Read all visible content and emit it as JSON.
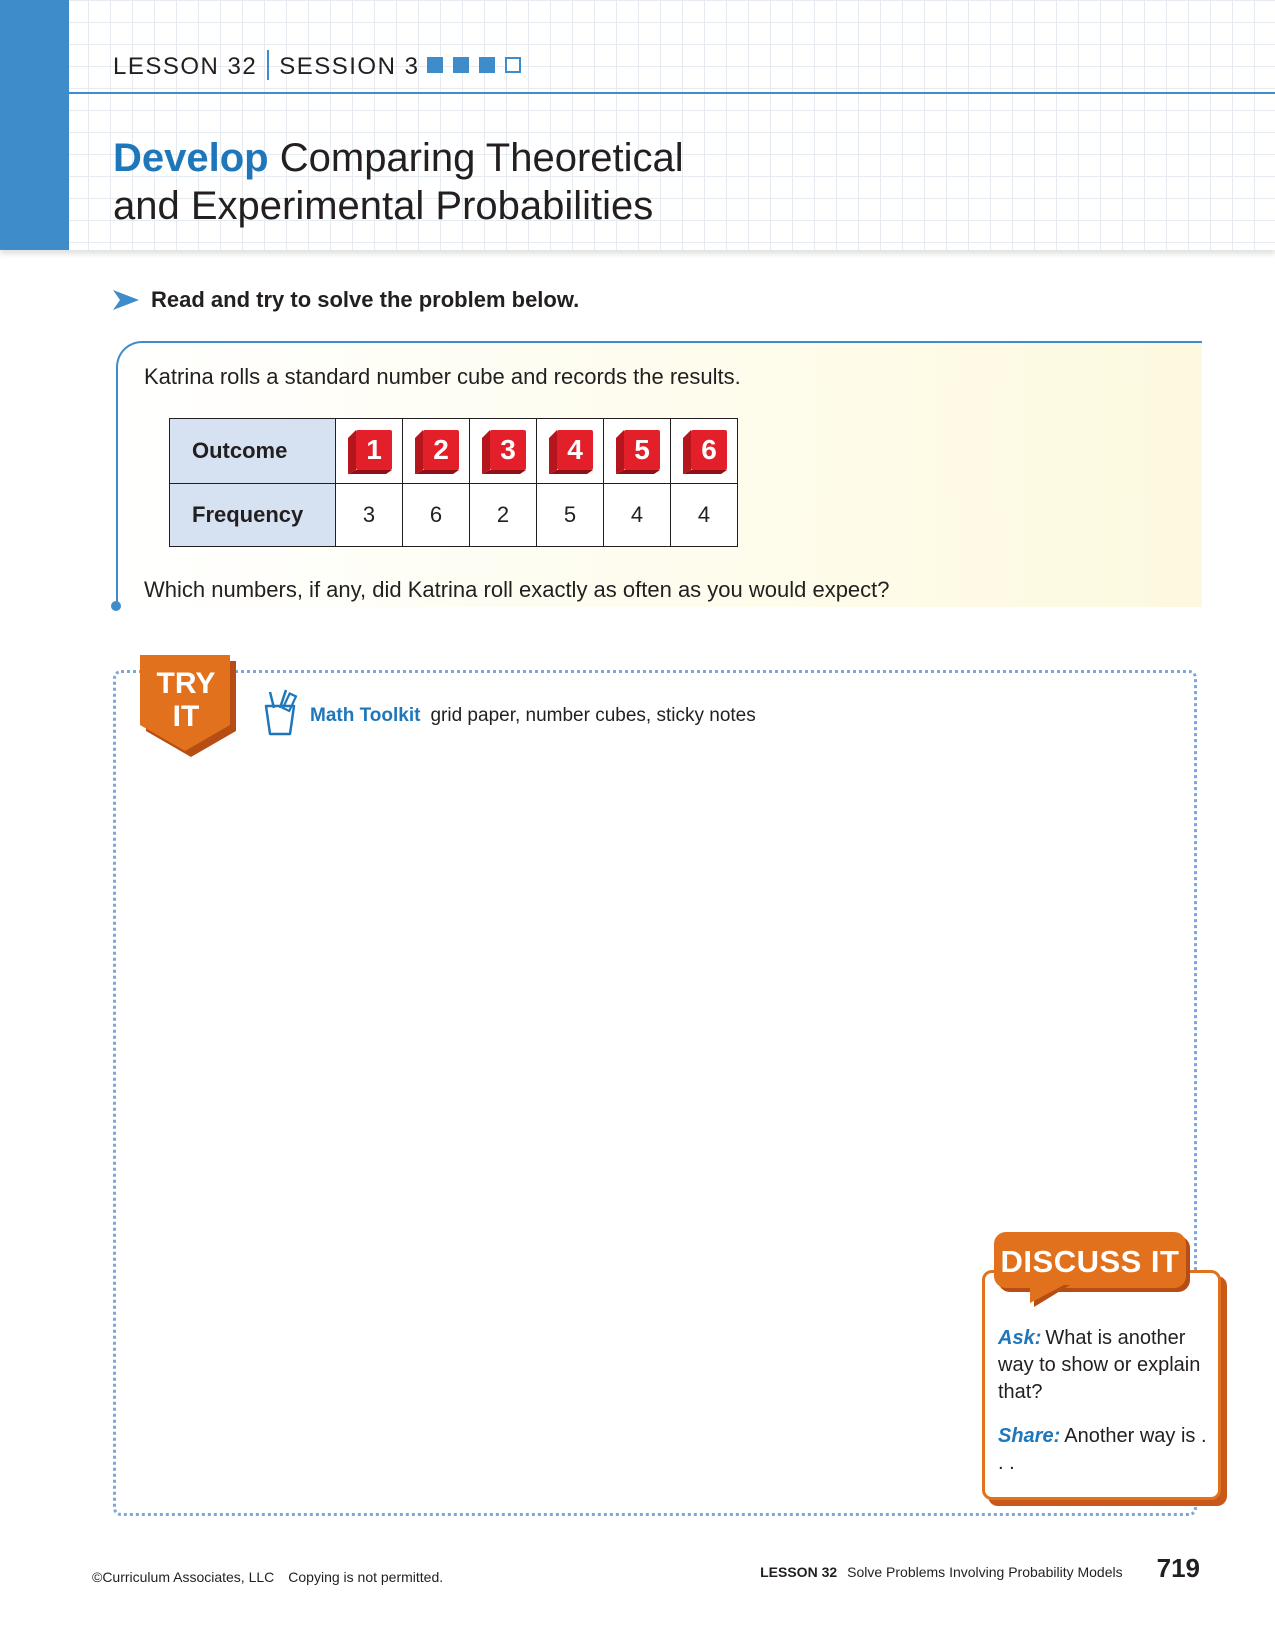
{
  "header": {
    "lesson": "LESSON 32",
    "session": "SESSION 3",
    "progress": [
      true,
      true,
      true,
      false
    ],
    "title_strong": "Develop",
    "title_rest": "Comparing Theoretical",
    "title_line2": "and Experimental Probabilities"
  },
  "instruction": "Read and try to solve the problem below.",
  "problem": {
    "intro": "Katrina rolls a standard number cube and records the results.",
    "table": {
      "row1_header": "Outcome",
      "row2_header": "Frequency",
      "outcomes": [
        "1",
        "2",
        "3",
        "4",
        "5",
        "6"
      ],
      "frequencies": [
        "3",
        "6",
        "2",
        "5",
        "4",
        "4"
      ]
    },
    "question": "Which numbers, if any, did Katrina roll exactly as often as you would expect?"
  },
  "try_it": {
    "line1": "TRY",
    "line2": "IT",
    "toolkit_label": "Math Toolkit",
    "toolkit_items": "grid paper, number cubes, sticky notes"
  },
  "discuss": {
    "title": "DISCUSS IT",
    "ask_label": "Ask:",
    "ask_text": "What is another way to show or explain that?",
    "share_label": "Share:",
    "share_text": "Another way is . . ."
  },
  "footer": {
    "copyright": "©Curriculum Associates, LLC",
    "notice": "Copying is not permitted.",
    "lesson": "LESSON 32",
    "lesson_title": "Solve Problems Involving Probability Models",
    "page_number": "719"
  },
  "colors": {
    "accent_blue": "#3e8cca",
    "title_blue": "#1f77bb",
    "orange": "#e2711d",
    "cube_red": "#e3202a",
    "table_header_bg": "#d6e1f1"
  }
}
